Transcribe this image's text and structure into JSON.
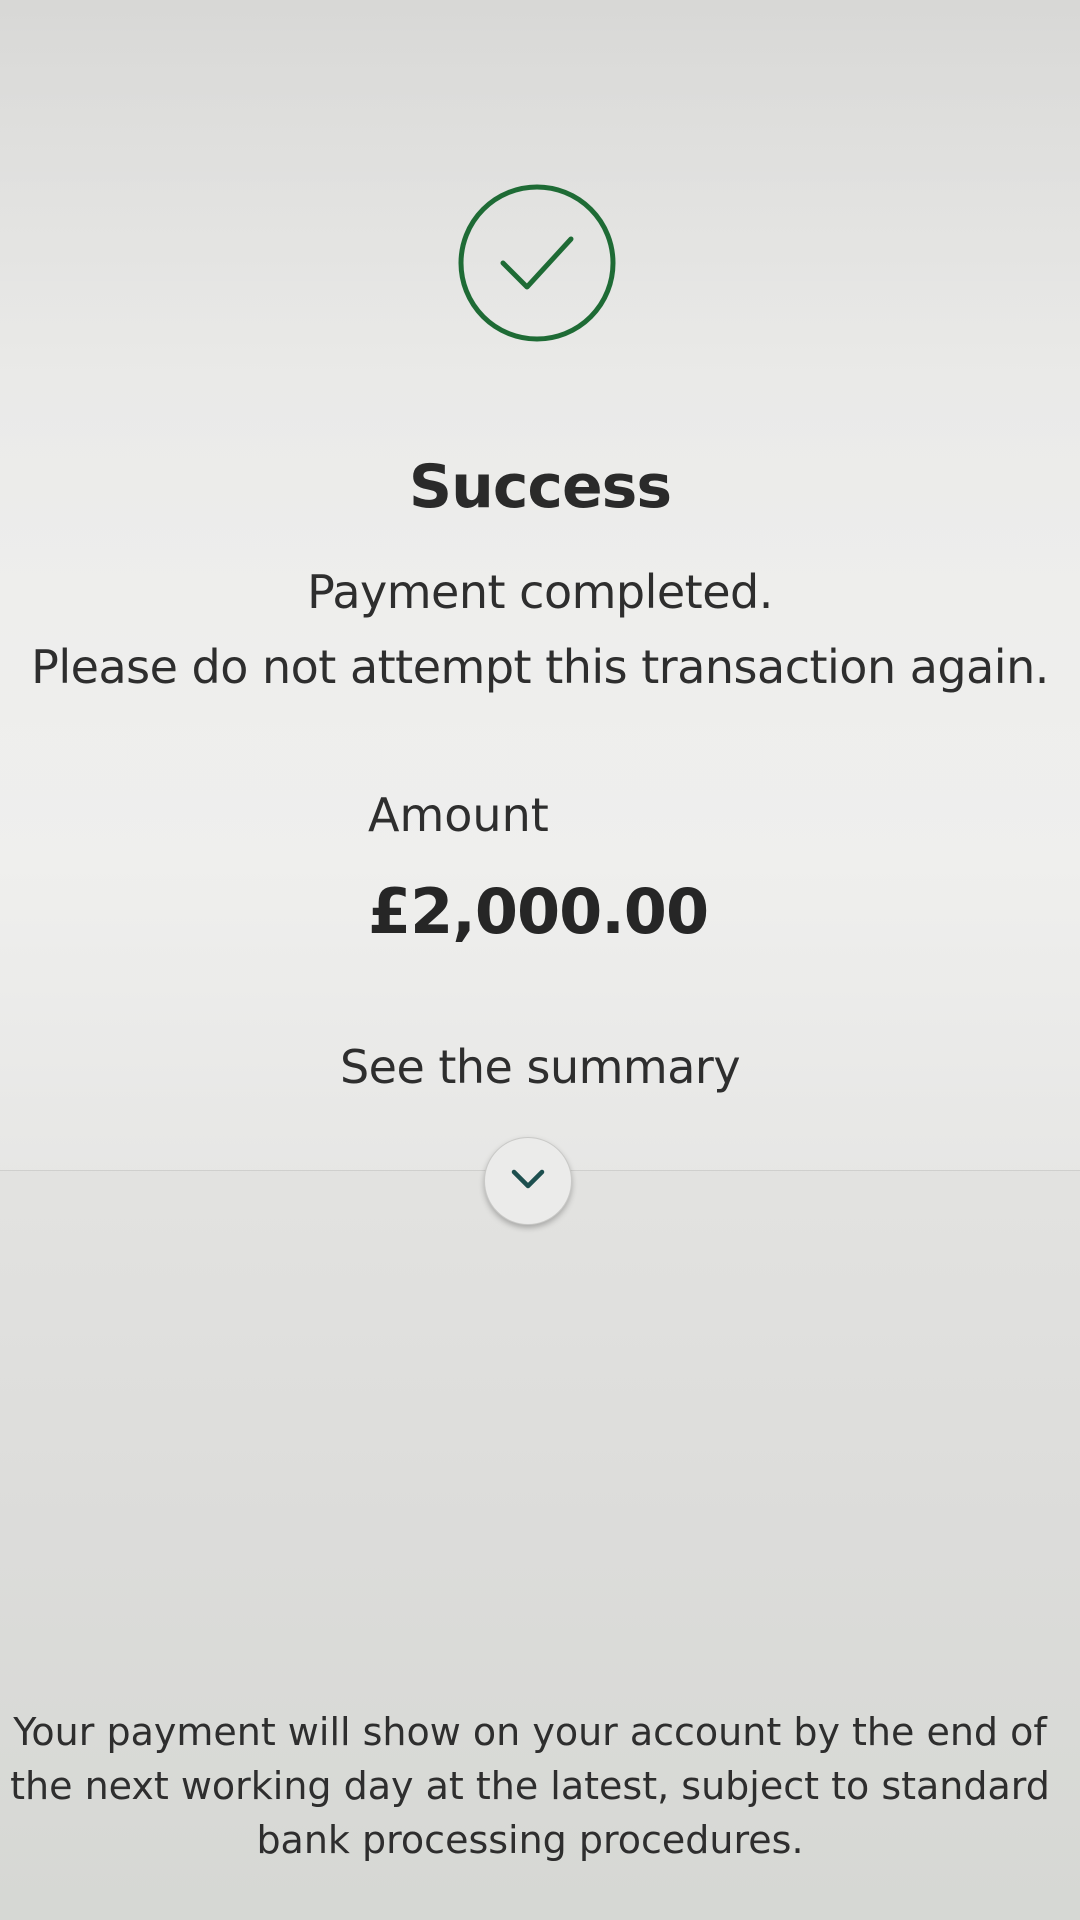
{
  "status": {
    "icon": "check-circle-icon",
    "title": "Success",
    "message": "Payment completed.",
    "warning": "Please do not attempt this transaction again."
  },
  "payment": {
    "amount_label": "Amount",
    "amount_value": "£2,000.00"
  },
  "summary": {
    "link_label": "See the summary",
    "expand_icon": "chevron-down-icon"
  },
  "footer": {
    "line1": "Your payment will show on your account by the end of",
    "line2": "the next working day at the latest, subject to standard",
    "line3": "bank processing procedures."
  },
  "colors": {
    "success_green": "#1e6b35",
    "chevron_teal": "#1d4f4f",
    "text": "#2e2e2e"
  }
}
